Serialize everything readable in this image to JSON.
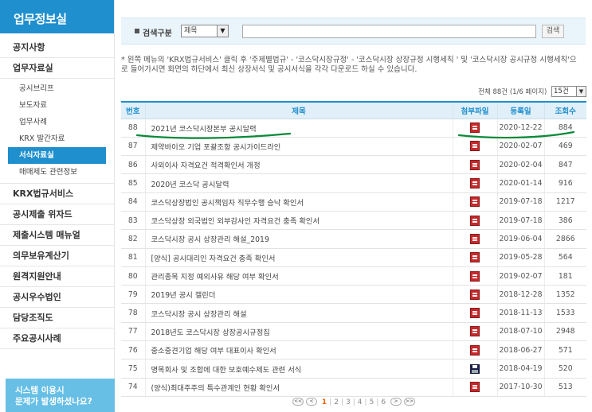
{
  "sidebar": {
    "header": "업무정보실",
    "items": [
      {
        "label": "공지사항"
      },
      {
        "label": "업무자료실"
      }
    ],
    "subitems": [
      {
        "label": "공시브리프"
      },
      {
        "label": "보도자료"
      },
      {
        "label": "업무사례"
      },
      {
        "label": "KRX 발간자료"
      },
      {
        "label": "서식자료실"
      },
      {
        "label": "매매제도 관련정보"
      }
    ],
    "items_after": [
      {
        "label": "KRX법규서비스"
      },
      {
        "label": "공시제출 위자드"
      },
      {
        "label": "제출시스템 매뉴얼"
      },
      {
        "label": "의무보유계산기"
      },
      {
        "label": "원격지원안내"
      },
      {
        "label": "공시우수법인"
      },
      {
        "label": "담당조직도"
      },
      {
        "label": "주요공시사례"
      }
    ],
    "banner_line1": "시스템 이용시",
    "banner_line2": "문제가 발생하셨나요?"
  },
  "search": {
    "label": "검색구분",
    "select_value": "제목",
    "input_value": "",
    "button_label": "검색"
  },
  "notice": "* 왼쪽 메뉴의 'KRX법규서비스' 클릭 후 '주제별법규' - '코스닥시장규정' - '코스닥시장 상장규정 시행세칙 ' 및 '코스닥시장 공시규정 시행세칙'으로 들어가시면 화면의 하단에서 최신 상장서식 및 공시서식을 각각 다운로드 하실 수 있습니다.",
  "listing": {
    "count_text": "전체 88건 (1/6 페이지)",
    "per_page": "15건"
  },
  "table": {
    "headers": {
      "no": "번호",
      "title": "제목",
      "file": "첨부파일",
      "date": "등록일",
      "views": "조회수"
    },
    "rows": [
      {
        "no": "88",
        "title": "2021년 코스닥시장본부 공시달력",
        "file": "pdf-icon",
        "date": "2020-12-22",
        "views": "884"
      },
      {
        "no": "87",
        "title": "제약바이오 기업 포괄조항 공시가이드라인",
        "file": "pdf-icon",
        "date": "2020-02-07",
        "views": "469"
      },
      {
        "no": "86",
        "title": "사외이사 자격요건 적격확인서 개정",
        "file": "pdf-icon",
        "date": "2020-02-04",
        "views": "847"
      },
      {
        "no": "85",
        "title": "2020년 코스닥 공시달력",
        "file": "pdf-icon",
        "date": "2020-01-14",
        "views": "916"
      },
      {
        "no": "84",
        "title": "코스닥상장법인 공시책임자 직무수행 승낙 확인서",
        "file": "pdf-icon",
        "date": "2019-07-18",
        "views": "1217"
      },
      {
        "no": "83",
        "title": "코스닥상장 외국법인 외부감사인 자격요건 충족 확인서",
        "file": "pdf-icon",
        "date": "2019-07-18",
        "views": "386"
      },
      {
        "no": "82",
        "title": "코스닥시장 공시 상장관리 해설_2019",
        "file": "pdf-icon",
        "date": "2019-06-04",
        "views": "2866"
      },
      {
        "no": "81",
        "title": "[양식] 공시대리인 자격요건 충족 확인서",
        "file": "pdf-icon",
        "date": "2019-05-28",
        "views": "564"
      },
      {
        "no": "80",
        "title": "관리종목 지정 예외사유 해당 여부 확인서",
        "file": "pdf-icon",
        "date": "2019-02-07",
        "views": "181"
      },
      {
        "no": "79",
        "title": "2019년 공시 캘린더",
        "file": "pdf-icon",
        "date": "2018-12-28",
        "views": "1352"
      },
      {
        "no": "78",
        "title": "코스닥시장 공시 상장관리 해설",
        "file": "pdf-icon",
        "date": "2018-11-13",
        "views": "1533"
      },
      {
        "no": "77",
        "title": "2018년도 코스닥시장 상장공시규정집",
        "file": "pdf-icon",
        "date": "2018-07-10",
        "views": "2948"
      },
      {
        "no": "76",
        "title": "중소중견기업 해당 여부 대표이사 확인서",
        "file": "pdf-icon",
        "date": "2018-06-27",
        "views": "571"
      },
      {
        "no": "75",
        "title": "명목회사 및 조합에 대한 보호예수제도 관련 서식",
        "file": "disk-icon",
        "date": "2018-04-19",
        "views": "520"
      },
      {
        "no": "74",
        "title": "(양식)최대주주의 특수관계인 현황 확인서",
        "file": "pdf-icon",
        "date": "2017-10-30",
        "views": "513"
      }
    ]
  },
  "pager": {
    "first": "<<",
    "prev": "<",
    "pages": [
      "1",
      "2",
      "3",
      "4",
      "5",
      "6"
    ],
    "current": "1",
    "next": ">",
    "last": ">>"
  },
  "colors": {
    "accent": "#1f8fce",
    "banner": "#67bfe6",
    "header_bg": "#e1eff8",
    "current_page": "#e8630a",
    "annotation": "#0a8a3a"
  }
}
